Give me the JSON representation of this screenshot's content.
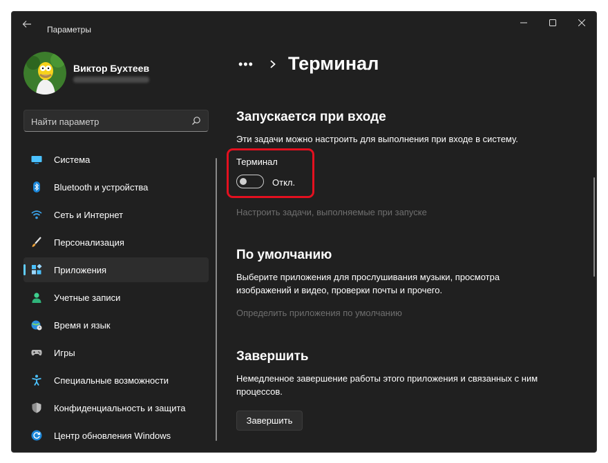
{
  "window": {
    "app_title": "Параметры"
  },
  "profile": {
    "name": "Виктор Бухтеев"
  },
  "search": {
    "placeholder": "Найти параметр"
  },
  "sidebar": {
    "items": [
      {
        "label": "Система",
        "icon": "monitor-icon",
        "active": false
      },
      {
        "label": "Bluetooth и устройства",
        "icon": "bluetooth-icon",
        "active": false
      },
      {
        "label": "Сеть и Интернет",
        "icon": "wifi-icon",
        "active": false
      },
      {
        "label": "Персонализация",
        "icon": "brush-icon",
        "active": false
      },
      {
        "label": "Приложения",
        "icon": "apps-icon",
        "active": true
      },
      {
        "label": "Учетные записи",
        "icon": "person-icon",
        "active": false
      },
      {
        "label": "Время и язык",
        "icon": "globe-clock-icon",
        "active": false
      },
      {
        "label": "Игры",
        "icon": "gamepad-icon",
        "active": false
      },
      {
        "label": "Специальные возможности",
        "icon": "accessibility-icon",
        "active": false
      },
      {
        "label": "Конфиденциальность и защита",
        "icon": "shield-icon",
        "active": false
      },
      {
        "label": "Центр обновления Windows",
        "icon": "update-icon",
        "active": false
      }
    ]
  },
  "header": {
    "breadcrumb_more": "•••",
    "title": "Терминал"
  },
  "startup": {
    "title": "Запускается при входе",
    "description": "Эти задачи можно настроить для выполнения при входе в систему.",
    "item_label": "Терминал",
    "toggle_state": "Откл.",
    "toggle_on": false,
    "link": "Настроить задачи, выполняемые при запуске"
  },
  "defaults": {
    "title": "По умолчанию",
    "description": "Выберите приложения для прослушивания музыки, просмотра изображений и видео, проверки почты и прочего.",
    "link": "Определить приложения по умолчанию"
  },
  "terminate": {
    "title": "Завершить",
    "description": "Немедленное завершение работы этого приложения и связанных с ним процессов.",
    "button": "Завершить"
  },
  "colors": {
    "background": "#202020",
    "accent": "#60cdff",
    "highlight_box": "#e4101f"
  }
}
